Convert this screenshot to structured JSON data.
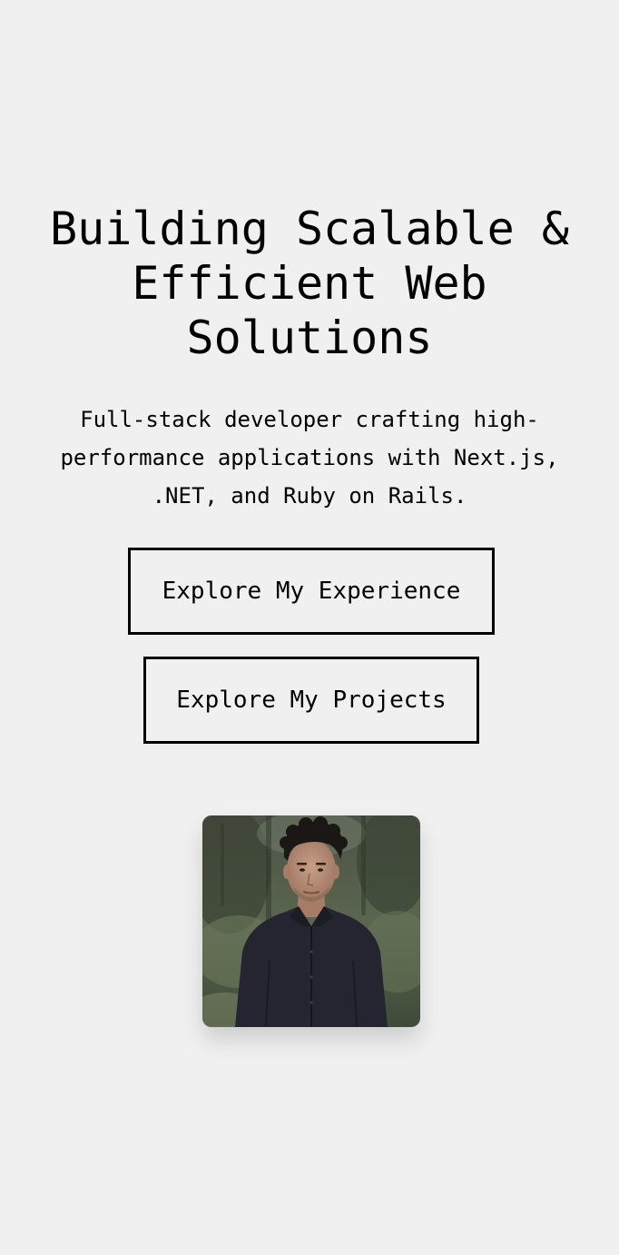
{
  "hero": {
    "title": "Building Scalable & Efficient Web Solutions",
    "subtitle": "Full-stack developer crafting high-performance applications with Next.js, .NET, and Ruby on Rails.",
    "buttons": {
      "experience_label": "Explore My Experience",
      "projects_label": "Explore My Projects"
    }
  },
  "colors": {
    "background": "#f0f0f0",
    "text": "#000000",
    "button_border": "#000000"
  }
}
